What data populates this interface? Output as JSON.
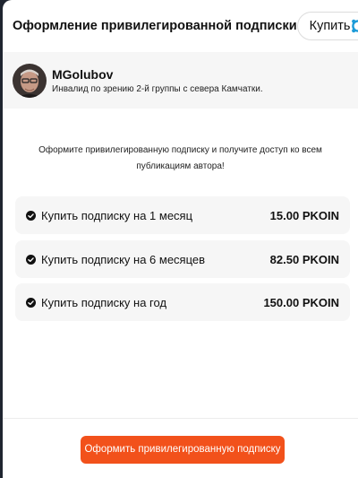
{
  "header": {
    "title": "Оформление привилегированной подписки",
    "buy_label": "Купить"
  },
  "author": {
    "name": "MGolubov",
    "description": "Инвалид по зрению 2-й группы с севера Камчатки."
  },
  "intro": "Оформите привилегированную подписку и получите доступ ко всем публикациям автора!",
  "plans": [
    {
      "label": "Купить подписку на 1 месяц",
      "price": "15.00 PKOIN"
    },
    {
      "label": "Купить подписку на 6 месяцев",
      "price": "82.50 PKOIN"
    },
    {
      "label": "Купить подписку на год",
      "price": "150.00 PKOIN"
    }
  ],
  "cta_label": "Оформить привилегированную подписку",
  "colors": {
    "accent": "#f2511b",
    "buy_icon": "#1d9bd8",
    "card_bg": "#f6f6f6"
  },
  "icons": {
    "buy": "refresh-cycle-icon",
    "plan": "check-circle-icon"
  }
}
